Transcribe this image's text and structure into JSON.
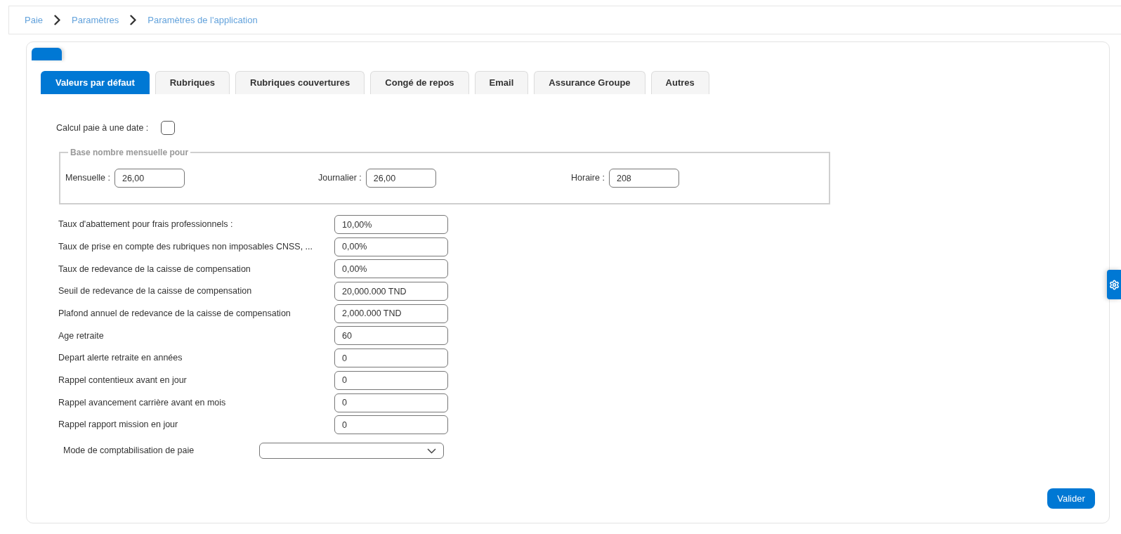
{
  "breadcrumb": [
    {
      "label": "Paie"
    },
    {
      "label": "Paramètres"
    },
    {
      "label": "Paramètres de l'application"
    }
  ],
  "tabs": [
    {
      "label": "Valeurs par défaut",
      "selected": true
    },
    {
      "label": "Rubriques",
      "selected": false
    },
    {
      "label": "Rubriques couvertures",
      "selected": false
    },
    {
      "label": "Congé de repos",
      "selected": false
    },
    {
      "label": "Email",
      "selected": false
    },
    {
      "label": "Assurance Groupe",
      "selected": false
    },
    {
      "label": "Autres",
      "selected": false
    }
  ],
  "pay_date_option": {
    "label": "Calcul paie à une date :",
    "checked": false
  },
  "monthly_base": {
    "legend": "Base nombre mensuelle pour",
    "fields": [
      {
        "label": "Mensuelle :",
        "value": "26,00"
      },
      {
        "label": "Journalier :",
        "value": "26,00"
      },
      {
        "label": "Horaire :",
        "value": "208"
      }
    ]
  },
  "settings": [
    {
      "label": "Taux d'abattement pour frais professionnels :",
      "value": "10,00%"
    },
    {
      "label": "Taux de prise en compte des rubriques non imposables CNSS, ...",
      "value": "0,00%"
    },
    {
      "label": "Taux de redevance de la caisse de compensation",
      "value": "0,00%"
    },
    {
      "label": "Seuil de redevance de la caisse de compensation",
      "value": "20,000.000 TND"
    },
    {
      "label": "Plafond annuel de redevance de la caisse de compensation",
      "value": "2,000.000 TND"
    },
    {
      "label": "Age retraite",
      "value": "60"
    },
    {
      "label": "Depart alerte retraite en années",
      "value": "0"
    },
    {
      "label": "Rappel contentieux avant en jour",
      "value": "0"
    },
    {
      "label": "Rappel avancement carrière avant en mois",
      "value": "0"
    },
    {
      "label": "Rappel rapport mission en jour",
      "value": "0"
    }
  ],
  "accounting_mode": {
    "label": "Mode de comptabilisation de paie"
  },
  "submit_button": "Valider"
}
